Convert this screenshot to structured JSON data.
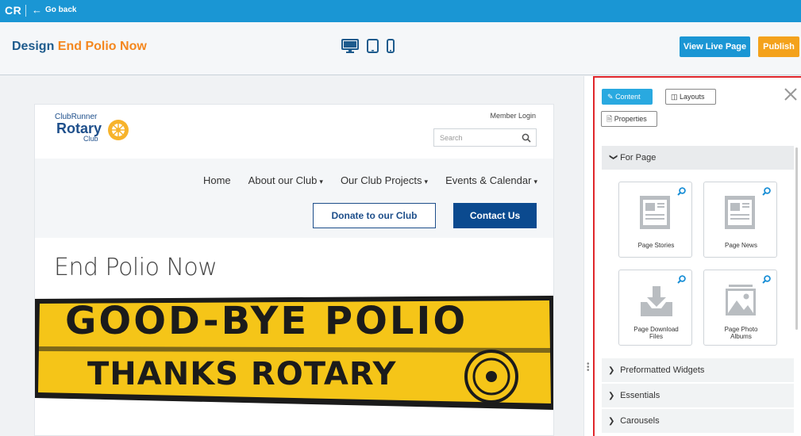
{
  "topbar": {
    "logo": "CR",
    "go_back": "Go back"
  },
  "header": {
    "title_prefix": "Design",
    "title_highlight": "End Polio Now",
    "devices": [
      "desktop-icon",
      "tablet-icon",
      "mobile-icon"
    ],
    "view_live_label": "View Live Page",
    "publish_label": "Publish"
  },
  "site": {
    "brand": {
      "line1": "ClubRunner",
      "line2": "Rotary",
      "line3": "Club"
    },
    "member_login": "Member Login",
    "search_placeholder": "Search",
    "nav": [
      "Home",
      "About our Club",
      "Our Club Projects",
      "Events & Calendar"
    ],
    "donate_label": "Donate to our Club",
    "contact_label": "Contact Us",
    "page_heading": "End Polio Now",
    "banner": {
      "line1": "GOOD-BYE POLIO",
      "line2": "THANKS ROTARY"
    }
  },
  "panel": {
    "tabs": {
      "content": "Content",
      "layouts": "Layouts",
      "properties": "Properties"
    },
    "section_open": "For Page",
    "cards": [
      {
        "label": "Page Stories",
        "icon": "document-icon"
      },
      {
        "label": "Page News",
        "icon": "document-icon"
      },
      {
        "label": "Page Download Files",
        "icon": "download-tray-icon"
      },
      {
        "label": "Page Photo Albums",
        "icon": "photo-icon"
      }
    ],
    "collapsed_sections": [
      "Preformatted Widgets",
      "Essentials",
      "Carousels"
    ]
  },
  "colors": {
    "topbar": "#1a96d4",
    "title_blue": "#1e5b8d",
    "title_orange": "#f4871e",
    "publish": "#f4a21c",
    "panel_border": "#e0262b",
    "contact_btn": "#0b4a8f",
    "banner_yellow": "#f5c518"
  }
}
